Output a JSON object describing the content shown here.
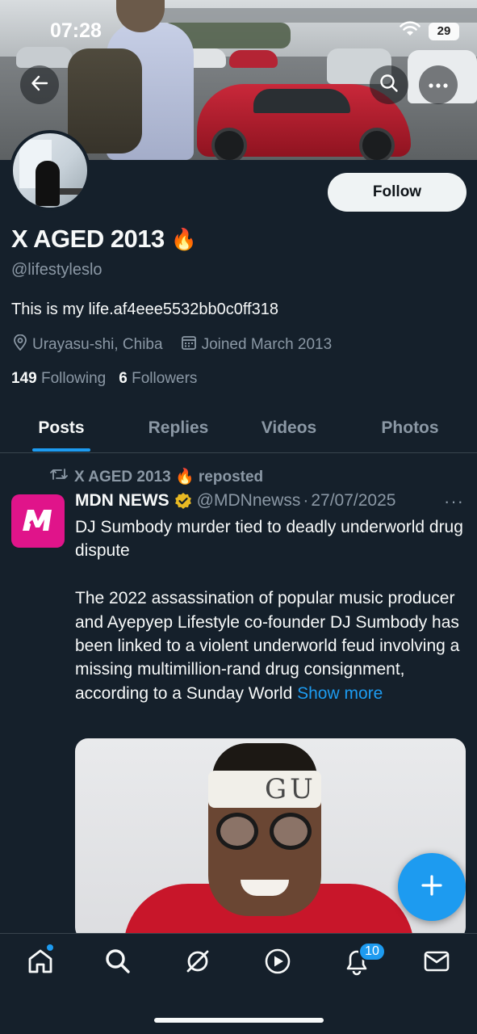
{
  "status_bar": {
    "time": "07:28",
    "battery": "29"
  },
  "profile": {
    "display_name": "X AGED 2013",
    "name_emoji": "🔥",
    "handle": "@lifestyleslo",
    "bio": "This is my life.af4eee5532bb0c0ff318",
    "location": "Urayasu-shi, Chiba",
    "joined": "Joined March 2013",
    "following_count": "149",
    "following_label": "Following",
    "followers_count": "6",
    "followers_label": "Followers",
    "follow_button": "Follow"
  },
  "tabs": [
    {
      "label": "Posts",
      "active": true
    },
    {
      "label": "Replies",
      "active": false
    },
    {
      "label": "Videos",
      "active": false
    },
    {
      "label": "Photos",
      "active": false
    }
  ],
  "tweet": {
    "repost_label": "X AGED 2013 🔥 reposted",
    "author_name": "MDN NEWS",
    "author_handle": "@MDNnewss",
    "separator": "·",
    "date": "27/07/2025",
    "more": "···",
    "headline": "DJ Sumbody murder tied to deadly underworld drug dispute",
    "body": "The 2022 assassination of popular music producer and Ayepyep Lifestyle co-founder DJ Sumbody has been linked to a violent underworld feud involving a missing multimillion-rand drug consignment, according to a Sunday World ",
    "show_more": "Show more",
    "media_text": "GU"
  },
  "bottom_nav": {
    "items": [
      "home-icon",
      "search-icon",
      "grok-icon",
      "video-icon",
      "notifications-icon",
      "messages-icon"
    ],
    "notifications_badge": "10"
  },
  "colors": {
    "background": "#15202b",
    "accent": "#1d9bf0",
    "muted_text": "#8b98a5",
    "primary_text": "#f7f9f9",
    "border": "#38444d"
  }
}
